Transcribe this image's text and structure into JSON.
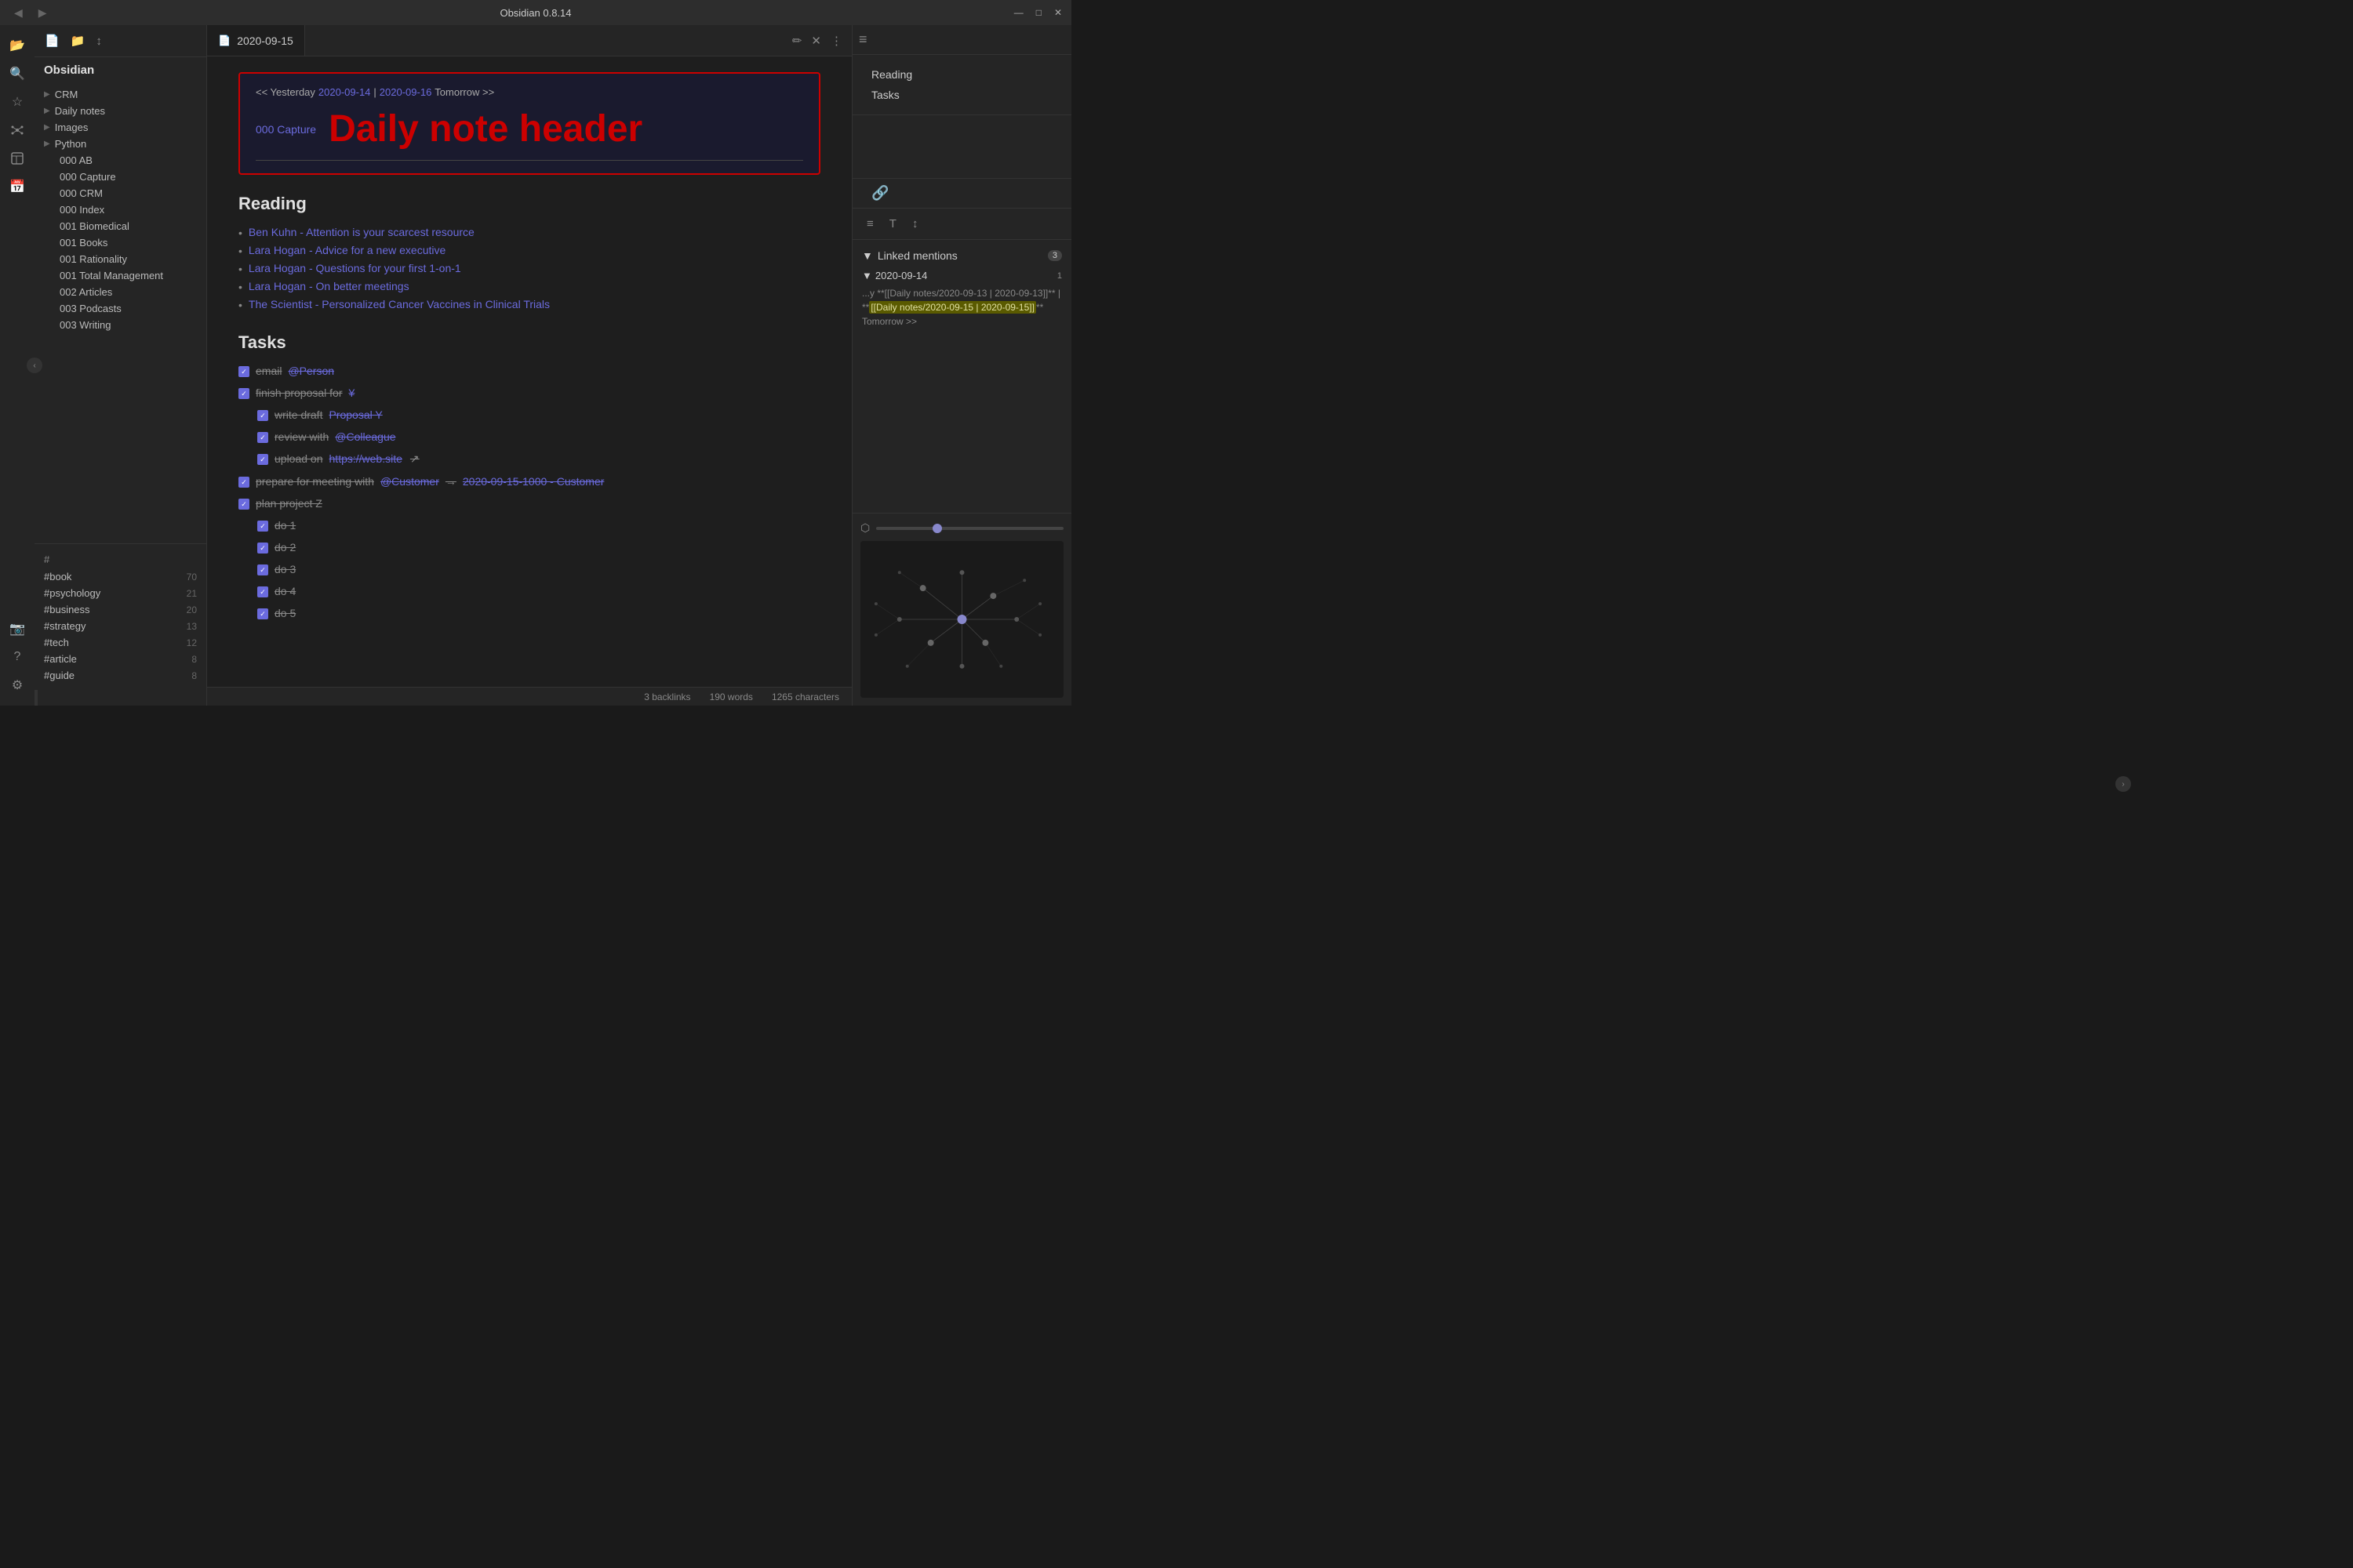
{
  "titlebar": {
    "title": "Obsidian 0.8.14",
    "nav_back": "◀",
    "nav_forward": "▶",
    "minimize": "—",
    "maximize": "□",
    "close": "✕"
  },
  "icon_rail": {
    "icons": [
      {
        "name": "open-folder-icon",
        "symbol": "📂"
      },
      {
        "name": "search-icon",
        "symbol": "🔍"
      },
      {
        "name": "star-icon",
        "symbol": "☆"
      },
      {
        "name": "graph-icon",
        "symbol": "⬡"
      },
      {
        "name": "template-icon",
        "symbol": "⊞"
      },
      {
        "name": "calendar-icon",
        "symbol": "📅"
      },
      {
        "name": "camera-icon",
        "symbol": "📷"
      },
      {
        "name": "help-icon",
        "symbol": "?"
      },
      {
        "name": "settings-icon",
        "symbol": "⚙"
      }
    ]
  },
  "sidebar": {
    "title": "Obsidian",
    "tools": [
      "new-file",
      "new-folder",
      "sort"
    ],
    "tree_items": [
      {
        "label": "CRM",
        "type": "folder",
        "has_arrow": true
      },
      {
        "label": "Daily notes",
        "type": "folder",
        "has_arrow": true
      },
      {
        "label": "Images",
        "type": "folder",
        "has_arrow": true
      },
      {
        "label": "Python",
        "type": "folder",
        "has_arrow": true
      },
      {
        "label": "000 AB",
        "type": "file"
      },
      {
        "label": "000 Capture",
        "type": "file"
      },
      {
        "label": "000 CRM",
        "type": "file"
      },
      {
        "label": "000 Index",
        "type": "file"
      },
      {
        "label": "001 Biomedical",
        "type": "file"
      },
      {
        "label": "001 Books",
        "type": "file"
      },
      {
        "label": "001 Rationality",
        "type": "file"
      },
      {
        "label": "001 Total Management",
        "type": "file"
      },
      {
        "label": "002 Articles",
        "type": "file"
      },
      {
        "label": "003 Podcasts",
        "type": "file"
      },
      {
        "label": "003 Writing",
        "type": "file"
      }
    ],
    "tags_header": "#",
    "tags": [
      {
        "label": "#book",
        "count": 70
      },
      {
        "label": "#psychology",
        "count": 21
      },
      {
        "label": "#business",
        "count": 20
      },
      {
        "label": "#strategy",
        "count": 13
      },
      {
        "label": "#tech",
        "count": 12
      },
      {
        "label": "#article",
        "count": 8
      },
      {
        "label": "#guide",
        "count": 8
      }
    ]
  },
  "tab": {
    "icon": "📄",
    "label": "2020-09-15",
    "edit_label": "✏",
    "close_label": "✕",
    "more_label": "⋮"
  },
  "note": {
    "nav_prefix": "<< Yesterday",
    "prev_date": "2020-09-14",
    "separator": "|",
    "next_date": "2020-09-16",
    "nav_suffix": "Tomorrow >>",
    "capture_link": "000 Capture",
    "header_title": "Daily note header",
    "reading_heading": "Reading",
    "reading_items": [
      "Ben Kuhn - Attention is your scarcest resource",
      "Lara Hogan - Advice for a new executive",
      "Lara Hogan - Questions for your first 1-on-1",
      "Lara Hogan - On better meetings",
      "The Scientist - Personalized Cancer Vaccines in Clinical Trials"
    ],
    "tasks_heading": "Tasks",
    "tasks": [
      {
        "text": "email ",
        "link": "@Person",
        "done": true,
        "indent": 0
      },
      {
        "text": "finish proposal for ",
        "link": "¥",
        "done": true,
        "indent": 0
      },
      {
        "text": "write draft ",
        "link": "Proposal Y",
        "done": true,
        "indent": 1
      },
      {
        "text": "review with ",
        "link": "@Colleague",
        "done": true,
        "indent": 1
      },
      {
        "text": "upload on ",
        "link": "https://web.site",
        "done": true,
        "indent": 1
      },
      {
        "text": "prepare for meeting with ",
        "link": "@Customer",
        "extra": "→ 2020-09-15-1000 - Customer",
        "done": true,
        "indent": 0
      },
      {
        "text": "plan project Z",
        "link": "",
        "done": true,
        "indent": 0
      },
      {
        "text": "do 1",
        "link": "",
        "done": true,
        "indent": 1
      },
      {
        "text": "do 2",
        "link": "",
        "done": true,
        "indent": 1
      },
      {
        "text": "do 3",
        "link": "",
        "done": true,
        "indent": 1
      },
      {
        "text": "do 4",
        "link": "",
        "done": true,
        "indent": 1
      },
      {
        "text": "do 5",
        "link": "",
        "done": true,
        "indent": 1
      }
    ]
  },
  "status_bar": {
    "backlinks": "3 backlinks",
    "words": "190 words",
    "chars": "1265 characters"
  },
  "right_panel": {
    "items": [
      {
        "label": "Reading"
      },
      {
        "label": "Tasks"
      }
    ],
    "toolbar_icons": [
      "≡",
      "T",
      "↕"
    ],
    "linked_mentions_title": "Linked mentions",
    "linked_mentions_count": "3",
    "mention_entry": {
      "title": "2020-09-14",
      "count": "1",
      "text_before": "...y **[[Daily notes/2020-09-13 | 2020-09-13]]** | **",
      "highlight1": "[[Daily notes/2020-09-15 | 2020-09-15]]",
      "text_after": "** Tomorrow >>"
    }
  }
}
